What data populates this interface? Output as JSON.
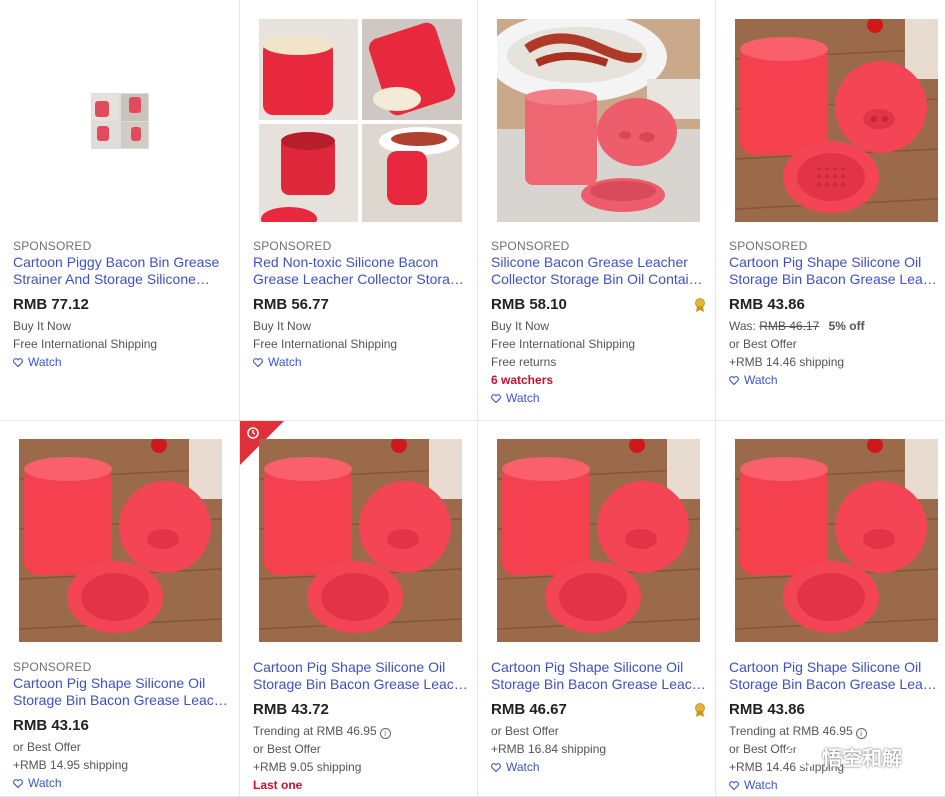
{
  "listings": [
    {
      "sponsored": "SPONSORED",
      "title_line1": "Cartoon Piggy Bacon Bin Grease",
      "title_line2": "Strainer And Storage Silicone…",
      "price": "RMB 77.12",
      "lines": [
        "Buy It Now",
        "Free International Shipping"
      ],
      "watch": "Watch"
    },
    {
      "sponsored": "SPONSORED",
      "title_line1": "Red Non-toxic Silicone Bacon",
      "title_line2": "Grease Leacher Collector Storag…",
      "price": "RMB 56.77",
      "lines": [
        "Buy It Now",
        "Free International Shipping"
      ],
      "watch": "Watch"
    },
    {
      "sponsored": "SPONSORED",
      "title_line1": "Silicone Bacon Grease Leacher",
      "title_line2": "Collector Storage Bin Oil Contain…",
      "price": "RMB 58.10",
      "lines": [
        "Buy It Now",
        "Free International Shipping",
        "Free returns"
      ],
      "alert": "6 watchers",
      "watch": "Watch"
    },
    {
      "sponsored": "SPONSORED",
      "title_line1": "Cartoon Pig Shape Silicone Oil",
      "title_line2": "Storage Bin Bacon Grease Leach…",
      "price": "RMB 43.86",
      "was_label": "Was:",
      "was_price": "RMB 46.17",
      "discount": "5% off",
      "lines": [
        "or Best Offer",
        "+RMB 14.46 shipping"
      ],
      "watch": "Watch"
    },
    {
      "sponsored": "SPONSORED",
      "title_line1": "Cartoon Pig Shape Silicone Oil",
      "title_line2": "Storage Bin Bacon Grease Leach…",
      "price": "RMB 43.16",
      "lines": [
        "or Best Offer",
        "+RMB 14.95 shipping"
      ],
      "watch": "Watch"
    },
    {
      "title_line1": "Cartoon Pig Shape Silicone Oil",
      "title_line2": "Storage Bin Bacon Grease Leach…",
      "price": "RMB 43.72",
      "trending": "Trending at RMB 46.95",
      "lines": [
        "or Best Offer",
        "+RMB 9.05 shipping"
      ],
      "alert": "Last one",
      "watch": "Watch"
    },
    {
      "title_line1": "Cartoon Pig Shape Silicone Oil",
      "title_line2": "Storage Bin Bacon Grease Leach…",
      "price": "RMB 46.67",
      "lines": [
        "or Best Offer",
        "+RMB 16.84 shipping"
      ],
      "watch": "Watch"
    },
    {
      "title_line1": "Cartoon Pig Shape Silicone Oil",
      "title_line2": "Storage Bin Bacon Grease Leach…",
      "price": "RMB 43.86",
      "trending": "Trending at RMB 46.95",
      "lines": [
        "or Best Offer",
        "+RMB 14.46 shipping"
      ],
      "watch": "Watch"
    }
  ],
  "info_glyph": "i",
  "watermark": "悟空和解",
  "colors": {
    "link": "#4050c0",
    "alert": "#c8102e",
    "product_red": "#f0506a",
    "ribbon": "#e0303a"
  }
}
